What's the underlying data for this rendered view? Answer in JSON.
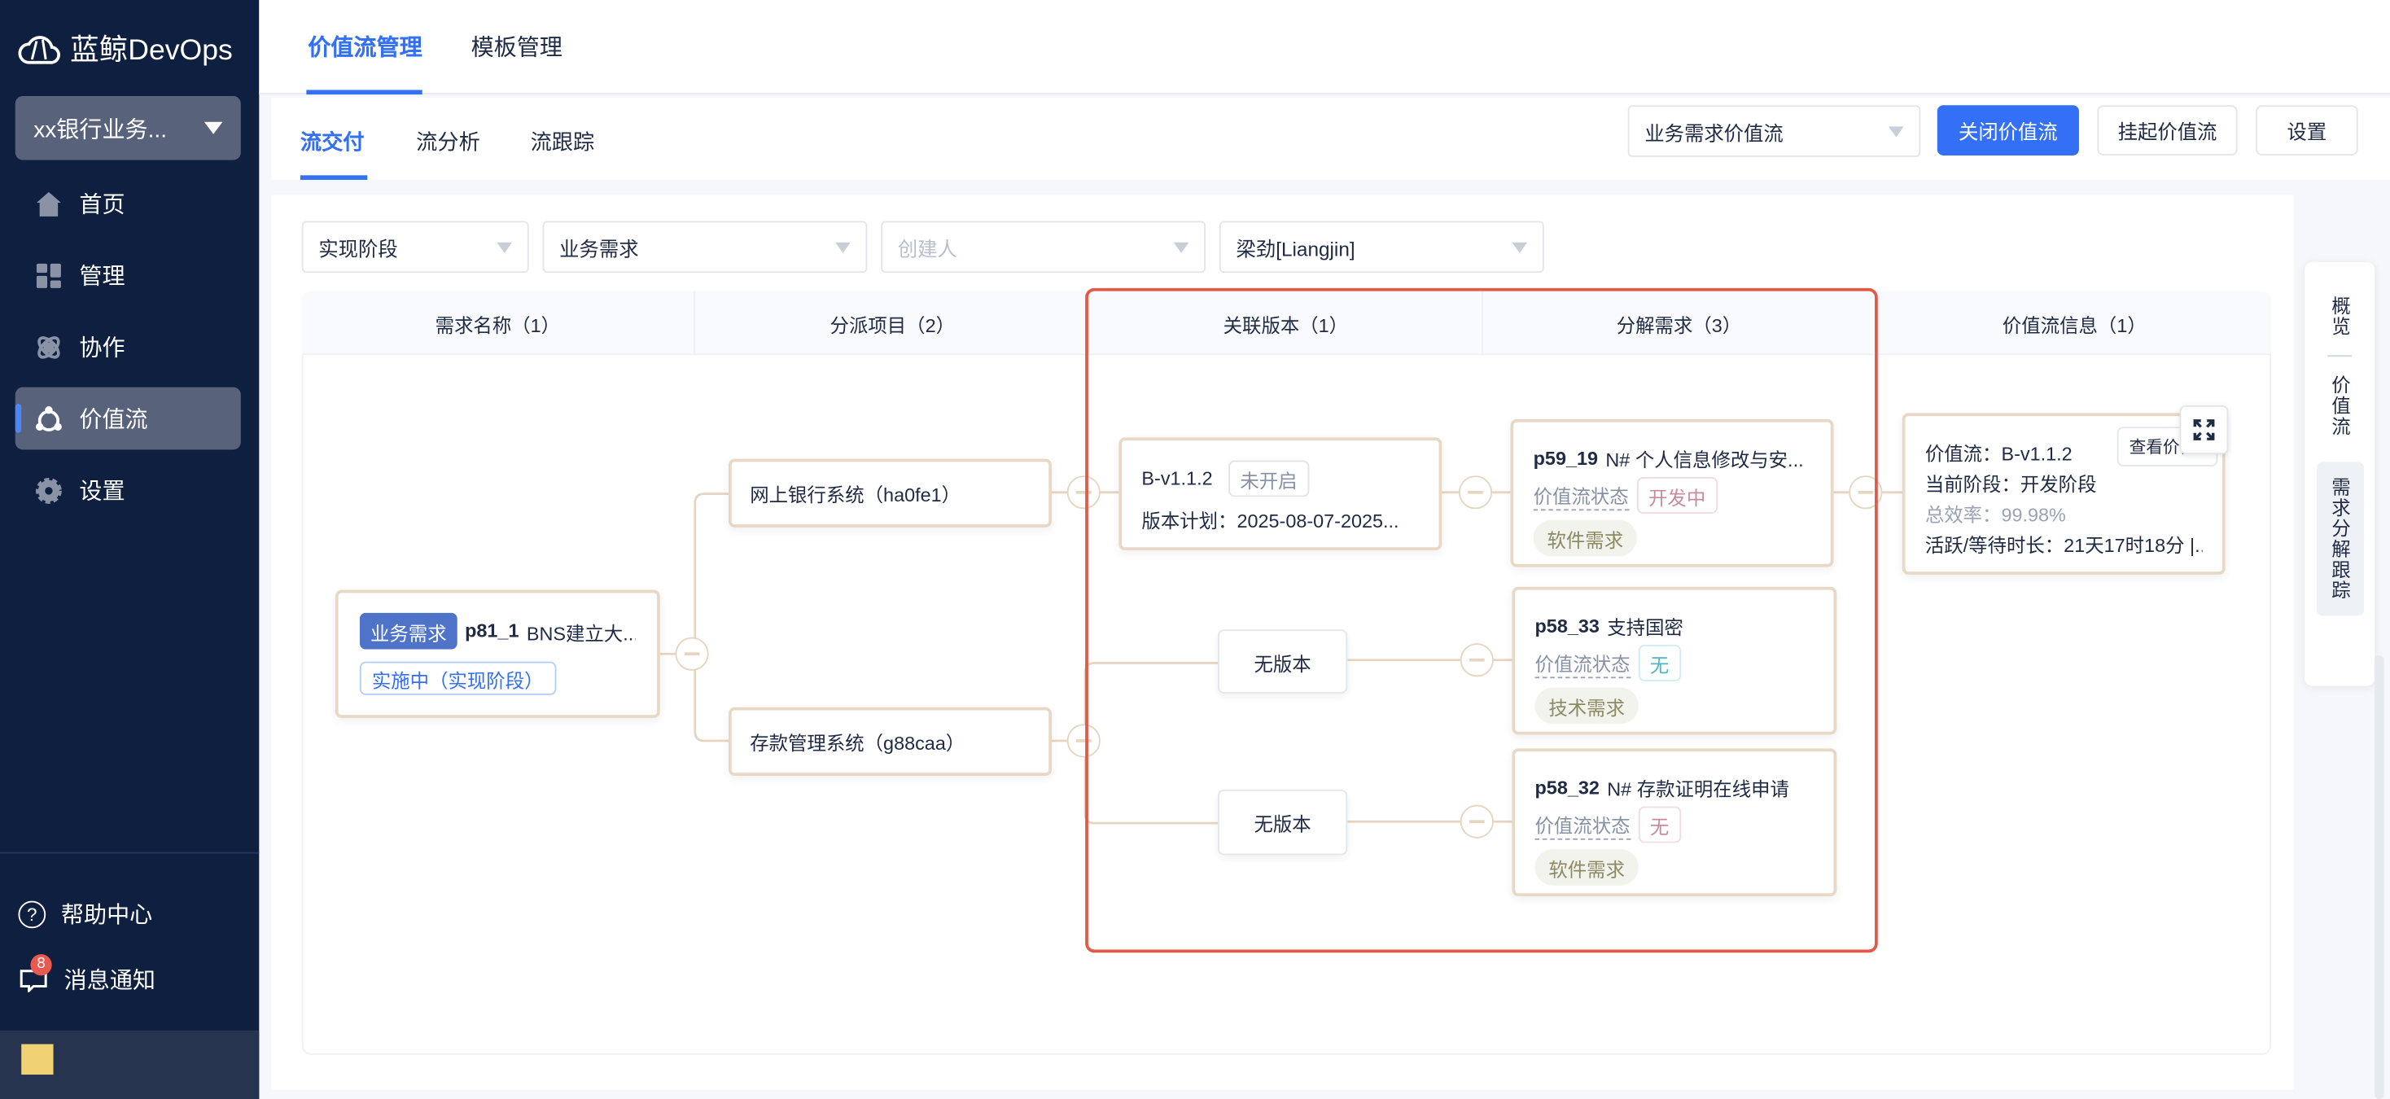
{
  "app": {
    "logo_text": "蓝鲸DevOps",
    "project": "xx银行业务...",
    "nav": [
      {
        "label": "首页",
        "icon": "home-icon"
      },
      {
        "label": "管理",
        "icon": "grid-icon"
      },
      {
        "label": "协作",
        "icon": "collab-icon"
      },
      {
        "label": "价值流",
        "icon": "value-stream-icon"
      },
      {
        "label": "设置",
        "icon": "gear-icon"
      }
    ],
    "help": "帮助中心",
    "messages": "消息通知",
    "message_count": "8"
  },
  "header": {
    "tabs": [
      "价值流管理",
      "模板管理"
    ],
    "active_tab": 0
  },
  "subheader": {
    "tabs": [
      "流交付",
      "流分析",
      "流跟踪"
    ],
    "active_tab": 0,
    "stream_select": "业务需求价值流",
    "close_btn": "关闭价值流",
    "suspend_btn": "挂起价值流",
    "settings_btn": "设置"
  },
  "filters": {
    "stage": "实现阶段",
    "type": "业务需求",
    "creator_placeholder": "创建人",
    "user": "梁劲[Liangjin]"
  },
  "columns": [
    "需求名称（1）",
    "分派项目（2）",
    "关联版本（1）",
    "分解需求（3）",
    "价值流信息（1）"
  ],
  "root": {
    "type_tag": "业务需求",
    "id": "p81_1",
    "title": "BNS建立大...",
    "status": "实施中（实现阶段）"
  },
  "projects": [
    "网上银行系统（ha0fe1）",
    "存款管理系统（g88caa）"
  ],
  "version": {
    "name": "B-v1.1.2",
    "status": "未开启",
    "plan": "版本计划：2025-08-07-2025..."
  },
  "no_version": "无版本",
  "requirements": [
    {
      "id": "p59_19",
      "title": "N# 个人信息修改与安...",
      "state_label": "价值流状态",
      "state": "开发中",
      "state_color": "#c98aa0",
      "category": "软件需求"
    },
    {
      "id": "p58_33",
      "title": "支持国密",
      "state_label": "价值流状态",
      "state": "无",
      "state_color": "#4fb6c0",
      "category": "技术需求"
    },
    {
      "id": "p58_32",
      "title": "N# 存款证明在线申请",
      "state_label": "价值流状态",
      "state": "无",
      "state_color": "#c98aa0",
      "category": "软件需求"
    }
  ],
  "info": {
    "stream": "价值流：B-v1.1.2",
    "stage": "当前阶段：开发阶段",
    "efficiency": "总效率：99.98%",
    "duration": "活跃/等待时长：21天17时18分 |...",
    "view_btn": "查看价值流"
  },
  "side_panel": [
    "概览",
    "价值流",
    "需求分解跟踪"
  ],
  "colors": {
    "sidebar": "#0f1f3f",
    "accent": "#3370f5",
    "highlight_box": "#e05a47",
    "card_border": "#e8d9c6"
  }
}
